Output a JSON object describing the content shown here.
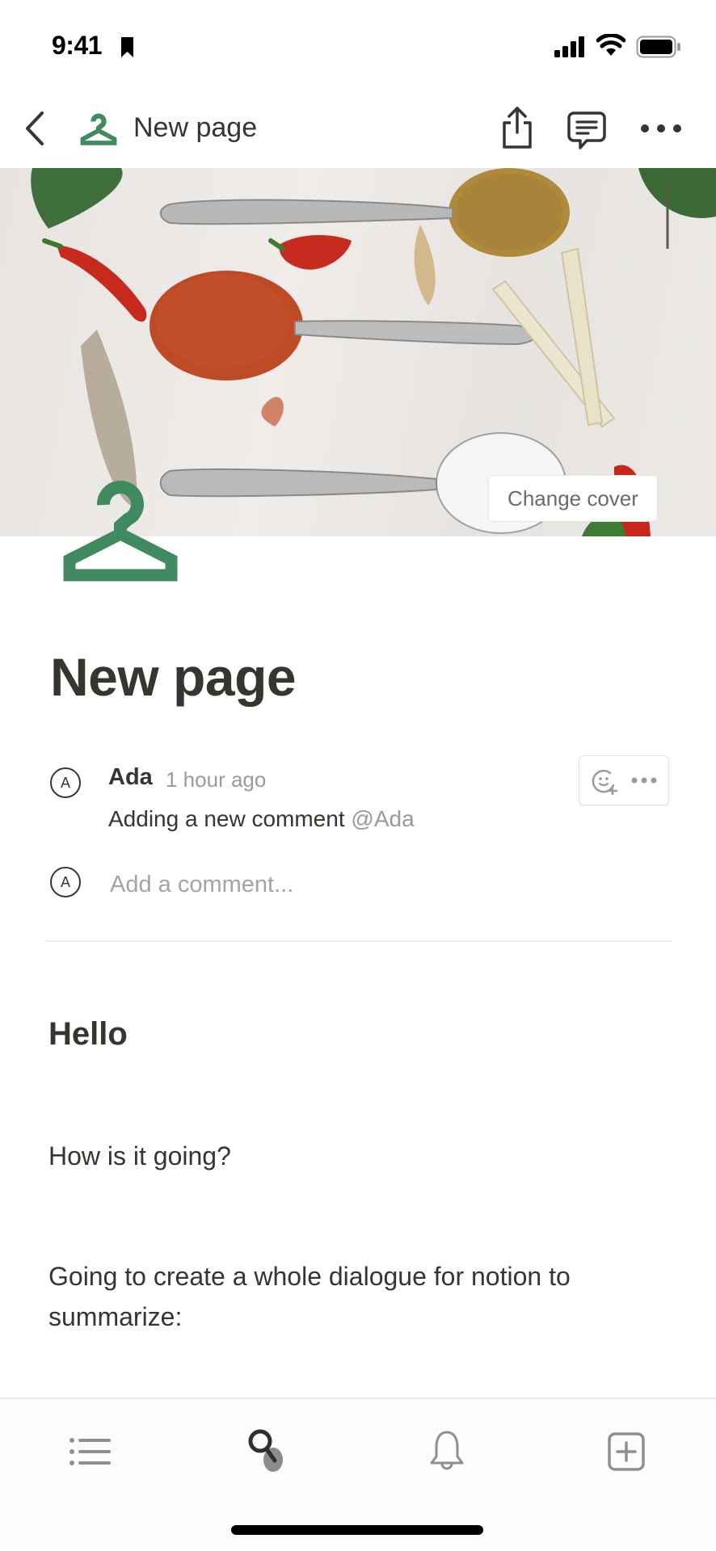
{
  "status_bar": {
    "time": "9:41",
    "icons": [
      "bookmark-icon",
      "signal-icon",
      "wifi-icon",
      "battery-icon"
    ]
  },
  "nav": {
    "back_icon": "chevron-left-icon",
    "page_icon": "clothes-hanger-icon",
    "title": "New page",
    "actions": [
      "share-icon",
      "comment-icon",
      "more-icon"
    ]
  },
  "cover": {
    "description": "Spices on spoons",
    "change_cover_label": "Change cover"
  },
  "page": {
    "icon": "clothes-hanger-icon",
    "icon_color": "#3f8a5f",
    "title": "New page"
  },
  "comments": [
    {
      "avatar_initial": "A",
      "author": "Ada",
      "time": "1 hour ago",
      "text": "Adding a new comment ",
      "mention": "@Ada"
    }
  ],
  "comment_actions": [
    "add-reaction-icon",
    "more-icon"
  ],
  "add_comment": {
    "avatar_initial": "A",
    "placeholder": "Add a comment..."
  },
  "blocks": [
    {
      "type": "heading",
      "text": "Hello"
    },
    {
      "type": "paragraph",
      "text": "How is it going?"
    },
    {
      "type": "paragraph",
      "text": "Going to create a whole dialogue for notion to summarize:"
    }
  ],
  "tab_bar": {
    "tabs": [
      {
        "icon": "sidebar-list-icon",
        "label": "Sidebar"
      },
      {
        "icon": "search-icon",
        "label": "Search",
        "active": true
      },
      {
        "icon": "bell-icon",
        "label": "Updates"
      },
      {
        "icon": "new-page-icon",
        "label": "New page"
      }
    ]
  }
}
